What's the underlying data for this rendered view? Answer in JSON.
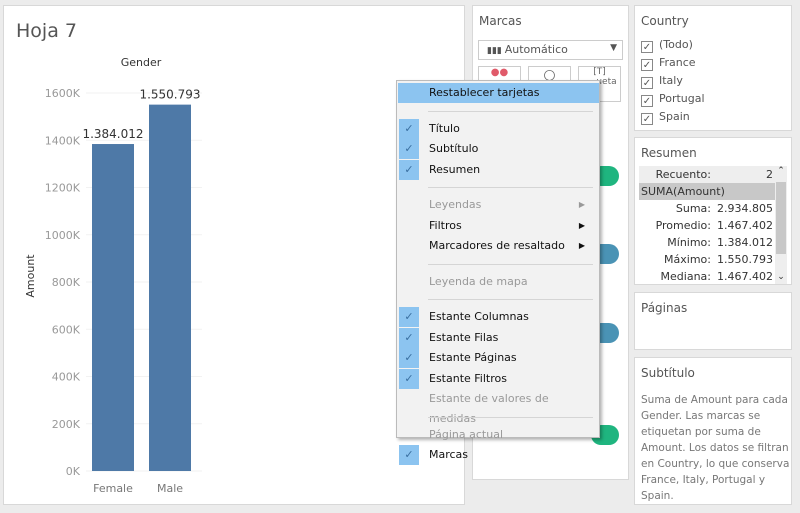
{
  "sheet": {
    "title": "Hoja 7"
  },
  "chart_data": {
    "type": "bar",
    "title": "",
    "column_header": "Gender",
    "categories": [
      "Female",
      "Male"
    ],
    "values": [
      1384012,
      1550793
    ],
    "data_labels": [
      "1.384.012",
      "1.550.793"
    ],
    "ylabel": "Amount",
    "ylim": [
      0,
      1600000
    ],
    "yticks": [
      "0K",
      "200K",
      "400K",
      "600K",
      "800K",
      "1000K",
      "1200K",
      "1400K",
      "1600K"
    ],
    "bar_color": "#4e79a7",
    "grid": true
  },
  "marcas": {
    "title": "Marcas",
    "mark_type": "Automático",
    "buttons": [
      "",
      "",
      "ueta"
    ],
    "pill_colors": [
      "#1fb57f",
      "#4a93b5",
      "#4a93b5",
      "#1fb57f"
    ]
  },
  "country": {
    "title": "Country",
    "items": [
      {
        "label": "(Todo)",
        "checked": true
      },
      {
        "label": "France",
        "checked": true
      },
      {
        "label": "Italy",
        "checked": true
      },
      {
        "label": "Portugal",
        "checked": true
      },
      {
        "label": "Spain",
        "checked": true
      }
    ]
  },
  "resumen": {
    "title": "Resumen",
    "count_label": "Recuento:",
    "count_value": "2",
    "measure": "SUMA(Amount)",
    "rows": [
      {
        "k": "Suma:",
        "v": "2.934.805"
      },
      {
        "k": "Promedio:",
        "v": "1.467.402"
      },
      {
        "k": "Mínimo:",
        "v": "1.384.012"
      },
      {
        "k": "Máximo:",
        "v": "1.550.793"
      },
      {
        "k": "Mediana:",
        "v": "1.467.402"
      }
    ]
  },
  "paginas": {
    "title": "Páginas"
  },
  "subtitulo": {
    "title": "Subtítulo",
    "text": "Suma de Amount para cada Gender.  Las marcas se etiquetan por suma de Amount. Los datos se filtran en Country, lo que conserva France, Italy, Portugal y Spain."
  },
  "menu": {
    "items": [
      {
        "label": "Restablecer tarjetas",
        "highlighted": true
      },
      {
        "sep": true
      },
      {
        "label": "Título",
        "checked": true
      },
      {
        "label": "Subtítulo",
        "checked": true
      },
      {
        "label": "Resumen",
        "checked": true
      },
      {
        "sep": true
      },
      {
        "label": "Leyendas",
        "disabled": true,
        "submenu": true
      },
      {
        "label": "Filtros",
        "submenu": true
      },
      {
        "label": "Marcadores de resaltado",
        "submenu": true
      },
      {
        "sep": true
      },
      {
        "label": "Leyenda de mapa",
        "disabled": true
      },
      {
        "sep": true
      },
      {
        "label": "Estante Columnas",
        "checked": true
      },
      {
        "label": "Estante Filas",
        "checked": true
      },
      {
        "label": "Estante Páginas",
        "checked": true
      },
      {
        "label": "Estante Filtros",
        "checked": true
      },
      {
        "label": "Estante de valores de medidas",
        "disabled": true
      },
      {
        "sep": true
      },
      {
        "label": "Página actual",
        "disabled": true
      },
      {
        "label": "Marcas",
        "checked": true
      }
    ]
  }
}
